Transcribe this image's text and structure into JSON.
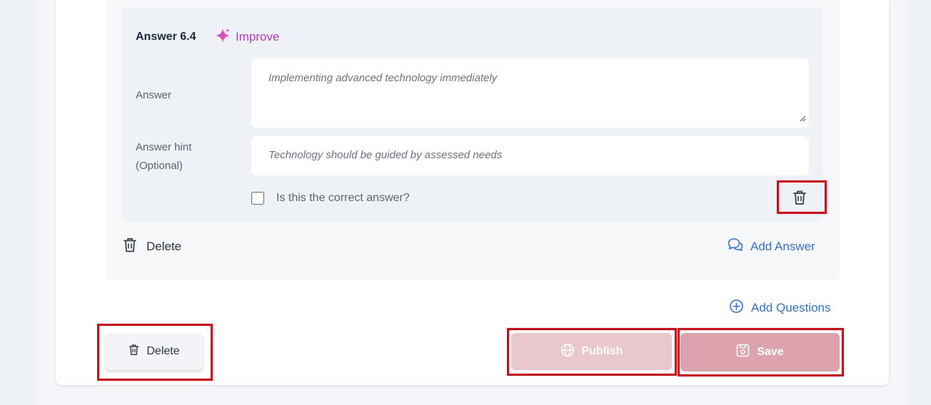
{
  "answer": {
    "title": "Answer 6.4",
    "improve_label": "Improve",
    "answer_label": "Answer",
    "answer_value": "Implementing advanced technology immediately",
    "hint_label_line1": "Answer hint",
    "hint_label_line2": "(Optional)",
    "hint_value": "Technology should be guided by assessed needs",
    "correct_checkbox_label": "Is this the correct answer?",
    "correct_checked": false
  },
  "question_actions": {
    "delete_label": "Delete",
    "add_answer_label": "Add Answer"
  },
  "add_questions_label": "Add Questions",
  "footer": {
    "delete_label": "Delete",
    "publish_label": "Publish",
    "save_label": "Save"
  },
  "icons": {
    "improve": "sparkle-icon",
    "trash": "trash-icon",
    "add_answer": "chat-bubbles-icon",
    "add_questions": "plus-circle-icon",
    "publish": "globe-icon",
    "save": "save-icon"
  },
  "colors": {
    "accent_blue": "#2f72d6",
    "improve_purple": "#b039c9",
    "publish_bg": "#e9c7cd",
    "save_bg": "#dca3ae",
    "highlight_red": "#e6000f"
  }
}
